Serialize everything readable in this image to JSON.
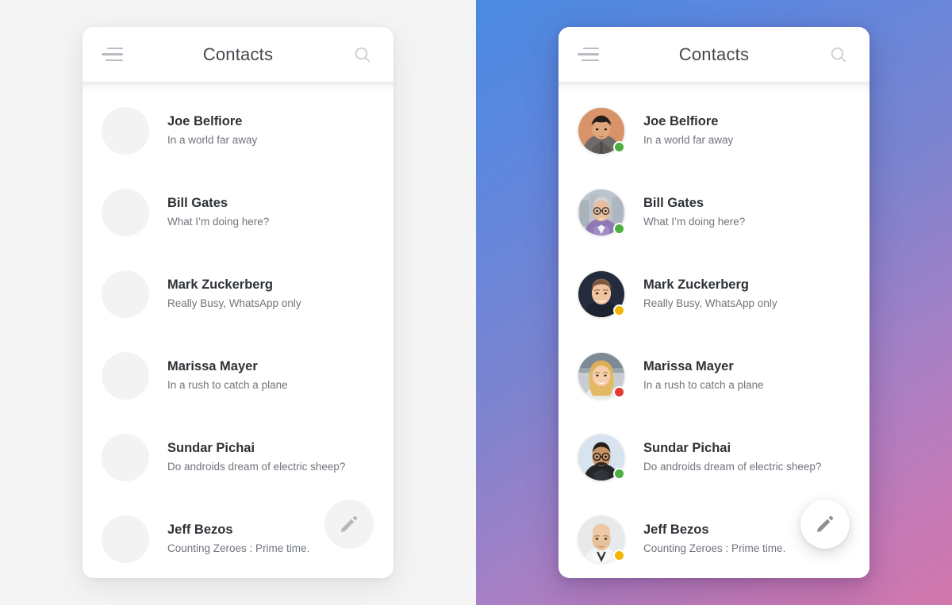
{
  "app": {
    "title": "Contacts",
    "menu_label": "Menu",
    "search_label": "Search",
    "compose_label": "Compose"
  },
  "icons": {
    "menu": "hamburger-menu-icon",
    "search": "search-icon",
    "compose": "pencil-edit-icon"
  },
  "colors": {
    "status_online": "#4caf3f",
    "status_away": "#f2b600",
    "status_busy": "#e53935",
    "left_background": "#f4f4f5",
    "gradient_start": "#4a8ae0",
    "gradient_mid": "#7b84d0",
    "gradient_end": "#d177ac",
    "card_background": "#ffffff",
    "name_text": "#2e3236",
    "status_text": "#6f747b",
    "title_text": "#44474d"
  },
  "panels": [
    {
      "id": "left",
      "variant": "placeholder",
      "background": "solid-light-grey"
    },
    {
      "id": "right",
      "variant": "photos",
      "background": "blue-pink-gradient"
    }
  ],
  "contacts": [
    {
      "name": "Joe Belfiore",
      "status": "In a world far away",
      "presence": "online",
      "presence_color": "#4caf3f",
      "avatar": "avatar-joe-belfiore"
    },
    {
      "name": "Bill Gates",
      "status": "What I’m doing here?",
      "presence": "online",
      "presence_color": "#4caf3f",
      "avatar": "avatar-bill-gates"
    },
    {
      "name": "Mark Zuckerberg",
      "status": "Really Busy, WhatsApp only",
      "presence": "away",
      "presence_color": "#f2b600",
      "avatar": "avatar-mark-zuckerberg"
    },
    {
      "name": "Marissa Mayer",
      "status": "In a rush to catch a plane",
      "presence": "busy",
      "presence_color": "#e53935",
      "avatar": "avatar-marissa-mayer"
    },
    {
      "name": "Sundar Pichai",
      "status": "Do androids dream of electric sheep?",
      "presence": "online",
      "presence_color": "#4caf3f",
      "avatar": "avatar-sundar-pichai"
    },
    {
      "name": "Jeff Bezos",
      "status": "Counting Zeroes : Prime time.",
      "presence": "away",
      "presence_color": "#f2b600",
      "avatar": "avatar-jeff-bezos"
    }
  ]
}
